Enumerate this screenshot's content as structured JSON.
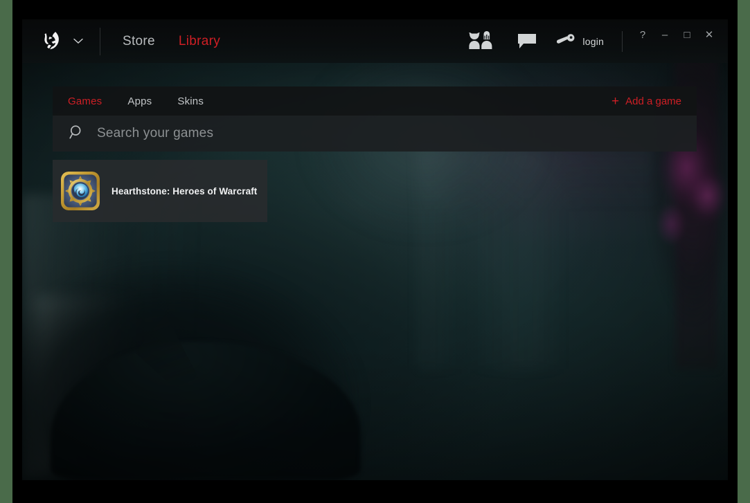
{
  "window": {
    "logo_icon": "wolf-head-logo",
    "logo_caret_icon": "chevron-down-icon"
  },
  "header": {
    "nav": [
      {
        "label": "Store",
        "active": false
      },
      {
        "label": "Library",
        "active": true
      }
    ],
    "friends_icon": "friends-characters-icon",
    "chat_icon": "chat-bubble-icon",
    "login": {
      "icon": "key-icon",
      "label": "login"
    },
    "window_controls": [
      {
        "name": "help-button",
        "glyph": "?"
      },
      {
        "name": "minimize-button",
        "glyph": "–"
      },
      {
        "name": "maximize-button",
        "glyph": "□"
      },
      {
        "name": "close-button",
        "glyph": "✕"
      }
    ]
  },
  "library": {
    "tabs": [
      {
        "label": "Games",
        "active": true
      },
      {
        "label": "Apps",
        "active": false
      },
      {
        "label": "Skins",
        "active": false
      }
    ],
    "add_game": {
      "plus": "+",
      "label": "Add a game"
    },
    "search": {
      "icon": "search-icon",
      "placeholder": "Search your games",
      "value": ""
    },
    "games": [
      {
        "title": "Hearthstone: Heroes of Warcraft",
        "icon": "hearthstone-icon"
      }
    ]
  },
  "colors": {
    "accent_red": "#cf1f25",
    "header_bg": "#0a0d0e",
    "panel_bg": "#1c1f21",
    "card_bg": "#2b2e30",
    "text_primary": "#e3e5e6",
    "text_muted": "#8d9193",
    "background_teal": "#1b3133"
  }
}
